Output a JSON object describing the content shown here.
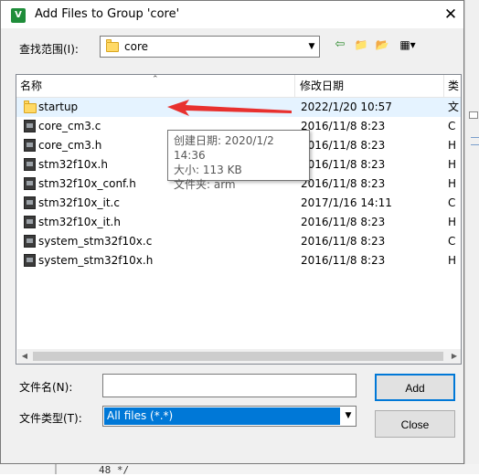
{
  "title": "Add Files to Group 'core'",
  "app_icon_text": "V",
  "close_glyph": "✕",
  "look_in": {
    "label": "查找范围(I):",
    "value": "core"
  },
  "toolbar": {
    "back": "⇦",
    "up_folder": "📁",
    "new_folder": "📂",
    "view_menu": "▦▾"
  },
  "columns": {
    "name": "名称",
    "date": "修改日期",
    "type": "类"
  },
  "files": [
    {
      "name": "startup",
      "date": "2022/1/20 10:57",
      "type": "文",
      "kind": "folder"
    },
    {
      "name": "core_cm3.c",
      "date": "2016/11/8 8:23",
      "type": "C",
      "kind": "file"
    },
    {
      "name": "core_cm3.h",
      "date": "2016/11/8 8:23",
      "type": "H",
      "kind": "file"
    },
    {
      "name": "stm32f10x.h",
      "date": "2016/11/8 8:23",
      "type": "H",
      "kind": "file"
    },
    {
      "name": "stm32f10x_conf.h",
      "date": "2016/11/8 8:23",
      "type": "H",
      "kind": "file"
    },
    {
      "name": "stm32f10x_it.c",
      "date": "2017/1/16 14:11",
      "type": "C",
      "kind": "file"
    },
    {
      "name": "stm32f10x_it.h",
      "date": "2016/11/8 8:23",
      "type": "H",
      "kind": "file"
    },
    {
      "name": "system_stm32f10x.c",
      "date": "2016/11/8 8:23",
      "type": "C",
      "kind": "file"
    },
    {
      "name": "system_stm32f10x.h",
      "date": "2016/11/8 8:23",
      "type": "H",
      "kind": "file"
    }
  ],
  "tooltip": {
    "created": "创建日期: 2020/1/2 14:36",
    "size": "大小: 113 KB",
    "folder": "文件夹: arm"
  },
  "file_name": {
    "label": "文件名(N):",
    "value": ""
  },
  "file_type": {
    "label": "文件类型(T):",
    "value": "All files (*.*)"
  },
  "buttons": {
    "add": "Add",
    "close": "Close"
  },
  "background": {
    "line_number": "48",
    "code_fragment": "*/"
  },
  "colors": {
    "selection": "#0078d7",
    "row_highlight": "#e5f3ff",
    "annotation_arrow": "#e8312f",
    "folder": "#ffd966"
  }
}
